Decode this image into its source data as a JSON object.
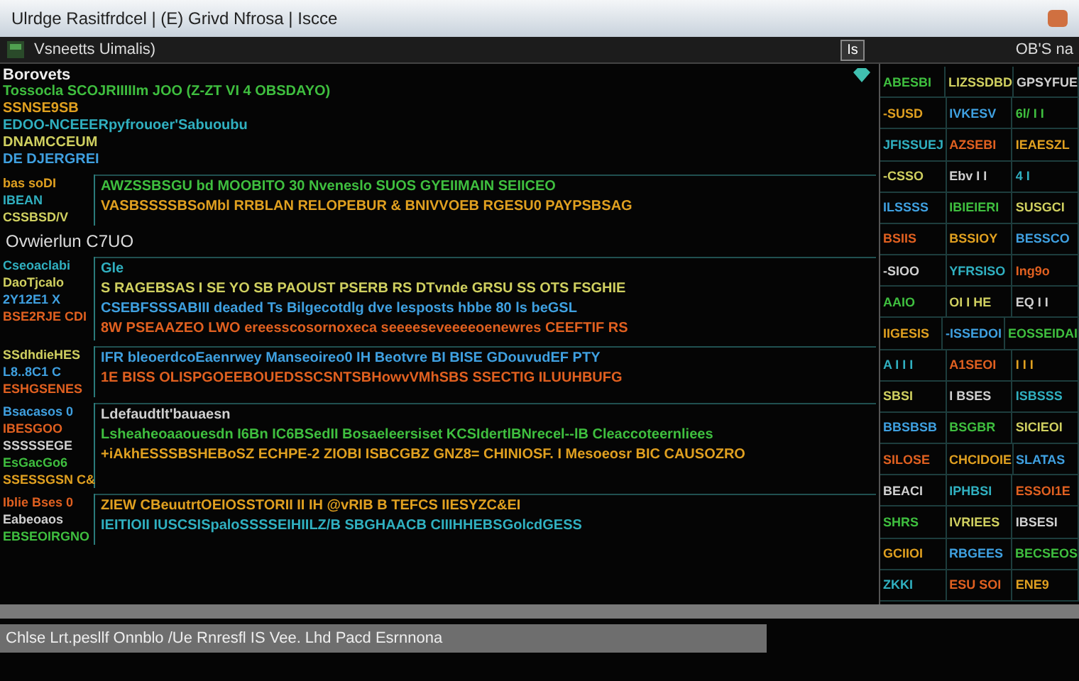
{
  "window": {
    "title": "Ulrdge Rasitfrdcel | (E) Grivd Nfrosa | Iscce"
  },
  "toolbar": {
    "label": "Vsneetts Uimalis)",
    "button": "Is",
    "right_label": "OB'S na"
  },
  "header": {
    "title": "Borovets",
    "lines": [
      "Tossocla SCOJRIIIIIm JOO (Z-ZT VI 4 OBSDAYO)",
      "SSNSE9SB",
      "EDOO-NCEEERpyfrouoer'Sabuoubu",
      "DNAMCCEUM",
      "DE DJERGREI"
    ]
  },
  "sections": [
    {
      "sidebar": [
        "bas soDI",
        "IBEAN",
        "CSSBSD/V"
      ],
      "lines": [
        "AWZSSBSGU bd MOOBITO 30 Nveneslo SUOS GYEIIMAIN SEIICEO",
        "VASBSSSSBSoMbl RRBLAN RELOPEBUR & BNIVVOEB RGESU0 PAYPSBSAG"
      ]
    },
    {
      "heading": "Ovwierlun C7UO",
      "sidebar": [
        "Cseoaclabi",
        "DaoTjcalo",
        "2Y12E1 X",
        "BSE2RJE CDI"
      ],
      "lines": [
        "Gle",
        "S RAGEBSAS I SE YO SB PAOUST PSERB RS DTvnde GRSU SS OTS FSGHIE",
        "CSEBFSSSABIII deaded Ts Bilgecotdlg dve lesposts hbbe 80 ls beGSL",
        "8W PSEAAZEO LWO ereesscosornoxeca seeeeseveeeeoenewres CEEFTIF RS"
      ]
    },
    {
      "sidebar": [
        "SSdhdieHES",
        "L8..8C1 C",
        "ESHGSENES"
      ],
      "lines": [
        "IFR bleoerdcoEaenrwey Manseoireo0 IH Beotvre BI BISE GDouvudEF PTY",
        "1E BISS OLISPGOEEBOUEDSSCSNTSBHowvVMhSBS SSECTIG ILUUHBUFG"
      ]
    },
    {
      "sidebar": [
        "Bsacasos 0",
        "IBESGOO",
        "SSSSSEGE",
        "EsGacGo6",
        "SSESSGSN C&"
      ],
      "lines": [
        "Ldefaudtlt'bauaesn",
        "Lsheaheoaaouesdn I6Bn IC6BSedII  Bosaeleersiset KCSIdertlBNrecel--lB Cleaccoteernliees",
        "+iAkhESSSBSHEBoSZ ECHPE-2 ZIOBI ISBCGBZ GNZ8= CHINIOSF. I Mesoeosr BIC CAUSOZRO"
      ]
    },
    {
      "sidebar": [
        "Iblie Bses 0",
        "Eabeoaos",
        "EBSEOIRGNO"
      ],
      "lines": [
        "ZIEW CBeuutrtOEIOSSTORII II IH @vRIB B TEFCS IIESYZC&EI",
        "IEITIOII IUSCSISpaloSSSSEIHIILZ/B SBGHAACB CIIIHHEBSGolcdGESS"
      ]
    }
  ],
  "grid": [
    [
      "ABESBI",
      "LIZSSDBD",
      "GPSYFUE"
    ],
    [
      "-SUSD",
      "IVKESV",
      "6l/ I I"
    ],
    [
      "JFISSUEJ",
      "AZSEBI",
      "IEAESZL"
    ],
    [
      "-CSSO",
      "Ebv I I",
      "4 I"
    ],
    [
      "ILSSSS",
      "IBIEIERI",
      "SUSGCI"
    ],
    [
      "BSIIS",
      "BSSIOY",
      "BESSCO"
    ],
    [
      "-SIOO",
      "YFRSISO",
      "Ing9o"
    ],
    [
      "AAIO",
      "OI I HE",
      "EQ I I"
    ],
    [
      "IIGESIS",
      "-ISSEDOI",
      "EOSSEIDAI"
    ],
    [
      "A I I I",
      "A1SEOI",
      "I I I"
    ],
    [
      "SBSI",
      "I BSES",
      "ISBSSS"
    ],
    [
      "BBSBSB",
      "BSGBR",
      "SICIEOI"
    ],
    [
      "SILOSE",
      "CHCIDOIE",
      "SLATAS"
    ],
    [
      "BEACI",
      "IPHBSI",
      "ESSOI1E"
    ],
    [
      "SHRS",
      "IVRIEES",
      "IBSESI"
    ],
    [
      "GCIIOI",
      "RBGEES",
      "BECSEOS"
    ],
    [
      "ZKKI",
      "ESU SOI",
      "ENE9"
    ]
  ],
  "status_bar": {
    "text": "Chlse Lrt.pesllf Onnblo /Ue Rnresfl IS Vee. Lhd Pacd Esrnnona"
  }
}
